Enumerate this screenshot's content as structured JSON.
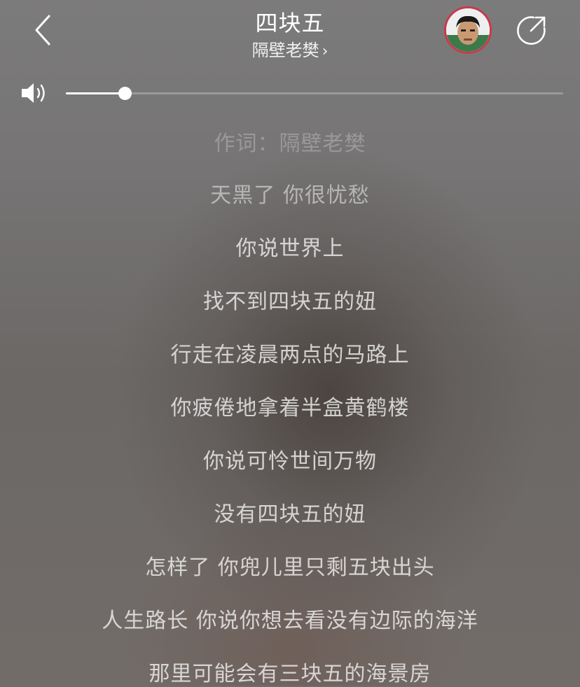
{
  "header": {
    "title": "四块五",
    "artist": "隔壁老樊",
    "artist_chevron": "›"
  },
  "volume": {
    "level": 0.12
  },
  "lyrics": [
    "作词：隔壁老樊",
    "天黑了 你很忧愁",
    "你说世界上",
    "找不到四块五的妞",
    "行走在凌晨两点的马路上",
    "你疲倦地拿着半盒黄鹤楼",
    "你说可怜世间万物",
    "没有四块五的妞",
    "怎样了 你兜儿里只剩五块出头",
    "人生路长 你说你想去看没有边际的海洋",
    "那里可能会有三块五的海景房"
  ],
  "colors": {
    "avatar_border": "#c83a4a",
    "text": "#ffffff"
  }
}
